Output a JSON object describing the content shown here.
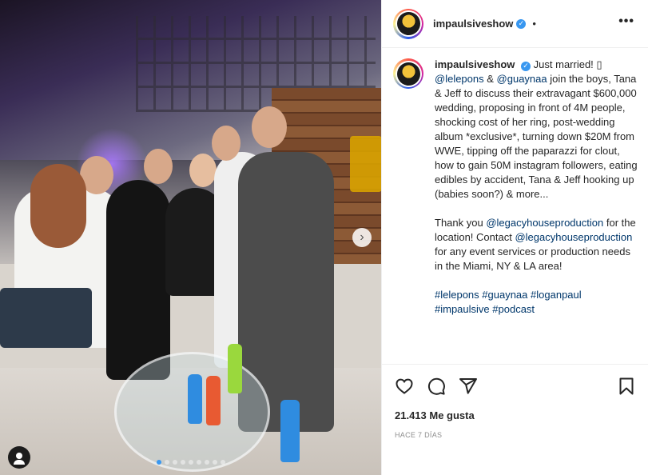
{
  "header": {
    "username": "impaulsiveshow",
    "verified_mark": "✓",
    "separator": "•",
    "more_icon": "•••"
  },
  "caption": {
    "username": "impaulsiveshow",
    "verified_mark": "✓",
    "line1_text": " Just married! ▯",
    "mention1": "@lelepons",
    "amp": " & ",
    "mention2": "@guaynaa",
    "body1": " join the boys, Tana & Jeff to discuss their extravagant $600,000 wedding, proposing in front of 4M people, shocking cost of her ring, post-wedding album *exclusive*, turning down $20M from WWE, tipping off the paparazzi for clout, how to gain 50M instagram followers, eating edibles by accident, Tana & Jeff hooking up (babies soon?) & more...",
    "thanks_prefix": "Thank you ",
    "mention3": "@legacyhouseproduction",
    "thanks_mid": " for the location! Contact ",
    "mention4": "@legacyhouseproduction",
    "thanks_end": " for any event services or production needs in the Miami, NY & LA area!",
    "hashtags": [
      "#lelepons",
      "#guaynaa",
      "#loganpaul",
      "#impaulsive",
      "#podcast"
    ]
  },
  "actions": {
    "icons": [
      "heart-icon",
      "comment-icon",
      "share-icon",
      "bookmark-icon"
    ],
    "likes": "21.413 Me gusta",
    "date": "HACE 7 DÍAS"
  },
  "carousel": {
    "next_glyph": "›",
    "slide_count": 9,
    "active_index": 0
  },
  "colors": {
    "link": "#00376b",
    "verified": "#3897f0",
    "active_dot": "#3897f0",
    "text": "#262626",
    "muted": "#8e8e8e"
  }
}
